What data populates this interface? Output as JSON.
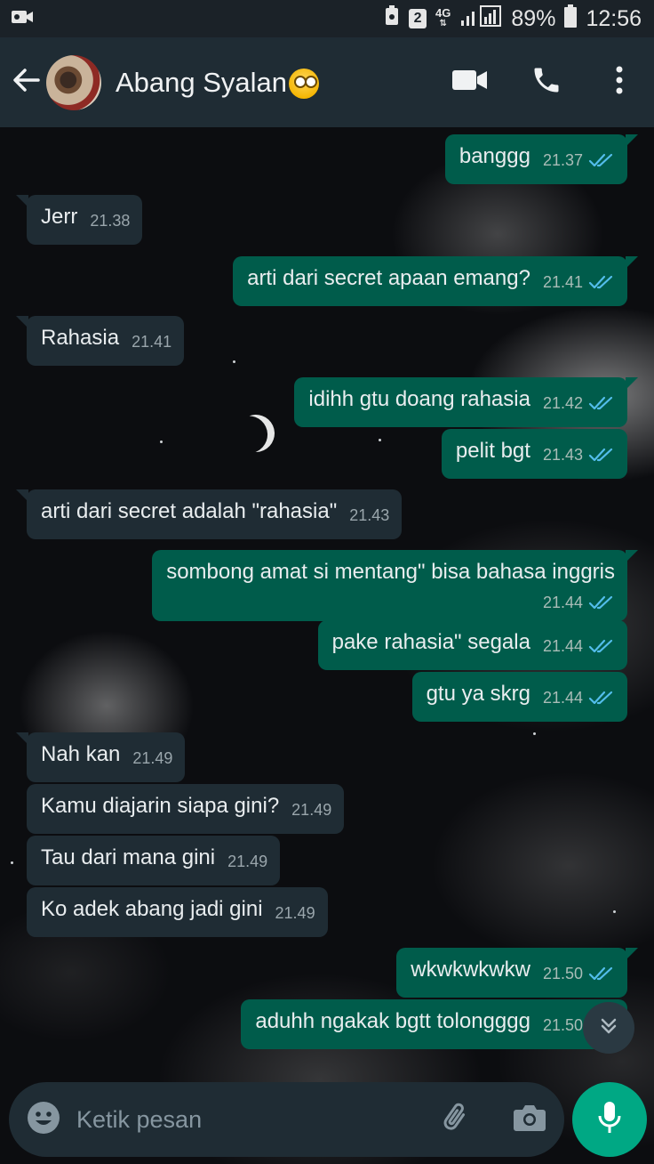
{
  "status_bar": {
    "sim_badge": "2",
    "network": "4G",
    "battery": "89%",
    "time": "12:56"
  },
  "header": {
    "contact_name": "Abang Syalan",
    "status_emoji": "face-with-rolling-eyes"
  },
  "messages": [
    {
      "dir": "out",
      "text": "banggg",
      "time": "21.37",
      "read": true
    },
    {
      "dir": "in",
      "text": "Jerr",
      "time": "21.38"
    },
    {
      "dir": "out",
      "text": "arti dari secret apaan emang?",
      "time": "21.41",
      "read": true
    },
    {
      "dir": "in",
      "text": "Rahasia",
      "time": "21.41"
    },
    {
      "dir": "out",
      "text": "idihh gtu doang rahasia",
      "time": "21.42",
      "read": true
    },
    {
      "dir": "out",
      "text": "pelit bgt",
      "time": "21.43",
      "read": true
    },
    {
      "dir": "in",
      "text": "arti dari secret adalah \"rahasia\"",
      "time": "21.43"
    },
    {
      "dir": "out",
      "text": "sombong amat si mentang\" bisa bahasa inggris",
      "time": "21.44",
      "read": true
    },
    {
      "dir": "out",
      "text": "pake rahasia\" segala",
      "time": "21.44",
      "read": true
    },
    {
      "dir": "out",
      "text": "gtu ya skrg",
      "time": "21.44",
      "read": true
    },
    {
      "dir": "in",
      "text": "Nah kan",
      "time": "21.49"
    },
    {
      "dir": "in",
      "text": "Kamu diajarin siapa gini?",
      "time": "21.49"
    },
    {
      "dir": "in",
      "text": "Tau dari mana gini",
      "time": "21.49"
    },
    {
      "dir": "in",
      "text": "Ko adek abang jadi gini",
      "time": "21.49"
    },
    {
      "dir": "out",
      "text": "wkwkwkwkw",
      "time": "21.50",
      "read": true
    },
    {
      "dir": "out",
      "text": "aduhh ngakak bgtt tolongggg",
      "time": "21.50",
      "read": true
    }
  ],
  "composer": {
    "placeholder": "Ketik pesan"
  },
  "colors": {
    "outgoing_bubble": "#005c4b",
    "incoming_bubble": "#1f2c34",
    "header": "#1f2c34",
    "read_ticks": "#53bdeb",
    "mic_button": "#00a884"
  }
}
